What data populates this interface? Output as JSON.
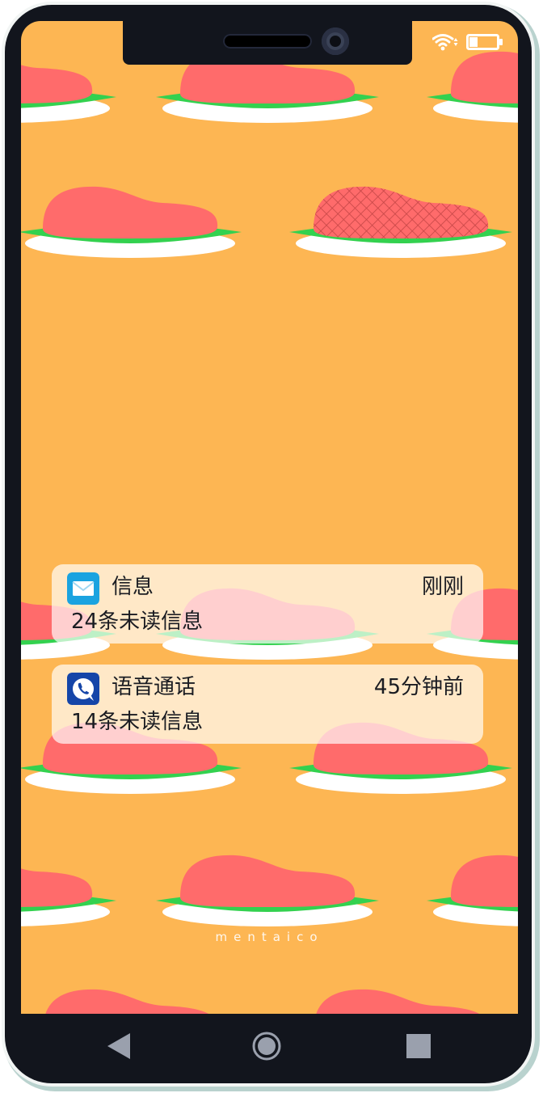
{
  "status_bar": {
    "wifi_icon": "wifi-icon",
    "battery_icon": "battery-icon",
    "battery_level": 0.3
  },
  "lockscreen": {
    "brand_text": "mentaico"
  },
  "notifications": [
    {
      "app": "信息",
      "time": "刚刚",
      "body": "24条未读信息",
      "icon": "mail-icon",
      "icon_color": "#1aa3e0"
    },
    {
      "app": "语音通话",
      "time": "45分钟前",
      "body": "14条未读信息",
      "icon": "phone-call-icon",
      "icon_color": "#1545a8"
    }
  ],
  "nav_bar": {
    "back_icon": "back-triangle-icon",
    "home_icon": "home-circle-icon",
    "recents_icon": "recents-square-icon"
  },
  "colors": {
    "wallpaper": "#fdb653",
    "meat": "#ff6b6b",
    "leaf": "#33d14f",
    "plate": "#ffffff",
    "frame": "#12151d"
  }
}
